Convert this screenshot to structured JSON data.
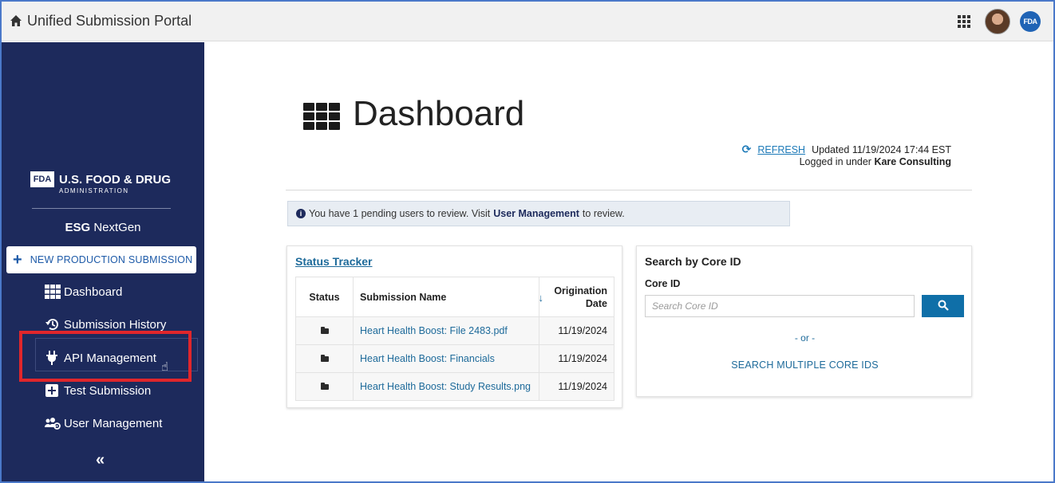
{
  "app": {
    "title": "Unified Submission Portal",
    "fda_badge": "FDA"
  },
  "sidebar": {
    "logo_box": "FDA",
    "logo_title": "U.S. FOOD & DRUG",
    "logo_subtitle": "ADMINISTRATION",
    "product_bold": "ESG",
    "product_rest": "NextGen",
    "new_submission_label": "NEW PRODUCTION SUBMISSION",
    "items": [
      {
        "label": "Dashboard"
      },
      {
        "label": "Submission History"
      },
      {
        "label": "API Management"
      },
      {
        "label": "Test Submission"
      },
      {
        "label": "User Management"
      }
    ],
    "collapse_label": "«"
  },
  "main": {
    "title": "Dashboard",
    "refresh_label": "REFRESH",
    "updated_text": "Updated 11/19/2024 17:44 EST",
    "logged_prefix": "Logged in under",
    "logged_org": "Kare Consulting",
    "alert_prefix": "You have 1 pending users to review. Visit",
    "alert_link": "User Management",
    "alert_suffix": "to review."
  },
  "status_tracker": {
    "title": "Status Tracker",
    "columns": {
      "status": "Status",
      "name": "Submission Name",
      "date_line1": "Origination",
      "date_line2": "Date"
    },
    "rows": [
      {
        "name": "Heart Health Boost: File 2483.pdf",
        "date": "11/19/2024"
      },
      {
        "name": "Heart Health Boost: Financials",
        "date": "11/19/2024"
      },
      {
        "name": "Heart Health Boost: Study Results.png",
        "date": "11/19/2024"
      }
    ]
  },
  "search": {
    "title": "Search by Core ID",
    "field_label": "Core ID",
    "placeholder": "Search Core ID",
    "or_text": "- or -",
    "multi_link": "SEARCH MULTIPLE CORE IDS"
  },
  "colors": {
    "sidebar_bg": "#1d2a5c",
    "link": "#1d6a9a",
    "search_button": "#0f6fa8",
    "highlight": "#e0262b"
  }
}
